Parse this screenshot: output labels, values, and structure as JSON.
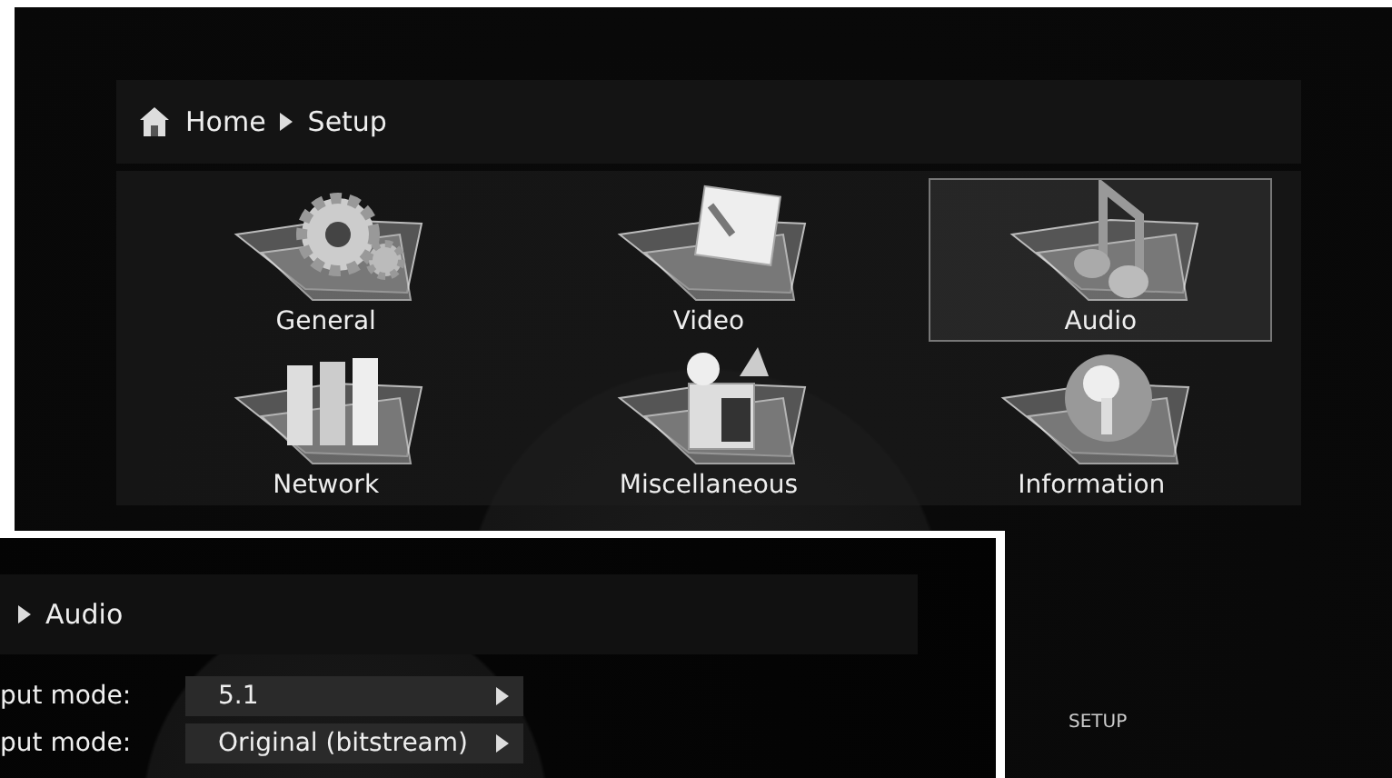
{
  "setup_screen": {
    "breadcrumb": [
      {
        "label": "Home"
      },
      {
        "label": "Setup"
      }
    ],
    "items": [
      {
        "label": "General",
        "kind": "gear",
        "selected": false
      },
      {
        "label": "Video",
        "kind": "picture",
        "selected": false
      },
      {
        "label": "Audio",
        "kind": "music",
        "selected": true
      },
      {
        "label": "Network",
        "kind": "server",
        "selected": false
      },
      {
        "label": "Miscellaneous",
        "kind": "box",
        "selected": false
      },
      {
        "label": "Information",
        "kind": "orb",
        "selected": false
      }
    ],
    "footer_label": "SETUP"
  },
  "audio_screen": {
    "breadcrumb": [
      {
        "label": "Audio"
      }
    ],
    "settings": [
      {
        "label": "put mode:",
        "value": "5.1"
      },
      {
        "label": "put mode:",
        "value": "Original (bitstream)"
      }
    ]
  }
}
